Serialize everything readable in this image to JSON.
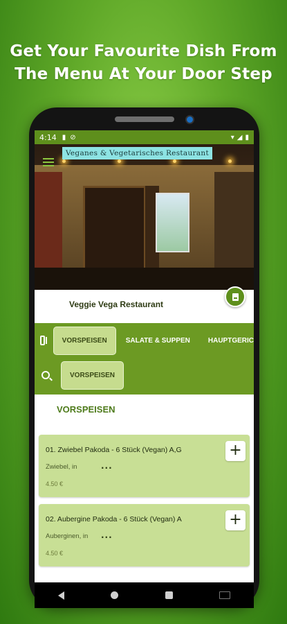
{
  "promo": {
    "line1": "Get Your Favourite Dish From",
    "line2": "The Menu At Your Door Step"
  },
  "status": {
    "time": "4:14"
  },
  "hero": {
    "sign_text": "Veganes & Vegetarisches Restaurant"
  },
  "restaurant": {
    "name": "Veggie Vega Restaurant"
  },
  "categories": {
    "tabs": [
      "VORSPEISEN",
      "SALATE & SUPPEN",
      "HAUPTGERIC"
    ],
    "active_tab": "VORSPEISEN",
    "search_chip": "VORSPEISEN"
  },
  "section": {
    "title": "VORSPEISEN"
  },
  "items": [
    {
      "name": "01. Zwiebel Pakoda - 6 Stück (Vegan) A,G",
      "desc": "Zwiebel, in",
      "more": "...",
      "price": "4.50 €",
      "add": "+"
    },
    {
      "name": "02. Aubergine Pakoda - 6 Stück (Vegan) A",
      "desc": "Auberginen, in",
      "more": "...",
      "price": "4.50 €",
      "add": "+"
    }
  ],
  "colors": {
    "accent": "#6c9a23",
    "item_bg": "#c8df95",
    "chip_bg": "#c6dc8e"
  }
}
